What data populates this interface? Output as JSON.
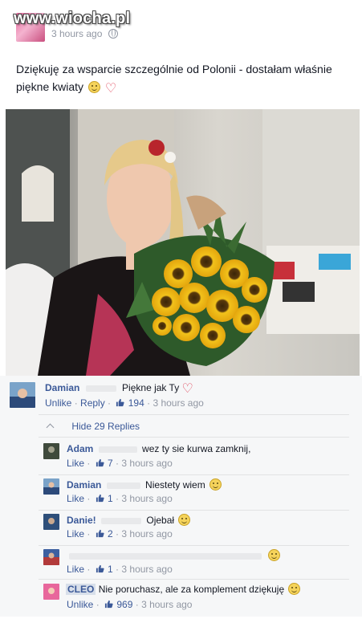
{
  "post": {
    "watermark": "www.wiocha.pl",
    "time": "3 hours ago",
    "text": "Dziękuję za wsparcie szczególnie od Polonii - dostałam właśnie piękne kwiaty",
    "icons": [
      "smile-icon",
      "heart-icon"
    ]
  },
  "comments": {
    "top": {
      "name": "Damian",
      "text": "Piękne jak Ty",
      "action": "Unlike",
      "reply": "Reply",
      "likes": "194",
      "time": "3 hours ago"
    },
    "hide_replies": "Hide 29 Replies",
    "replies": [
      {
        "name": "Adam",
        "text": "wez ty sie kurwa zamknij,",
        "action": "Like",
        "likes": "7",
        "time": "3 hours ago"
      },
      {
        "name": "Damian",
        "text": "Niestety wiem",
        "action": "Like",
        "likes": "1",
        "time": "3 hours ago"
      },
      {
        "name": "Danie!",
        "text": "Ojebał",
        "action": "Like",
        "likes": "2",
        "time": "3 hours ago"
      },
      {
        "name": "",
        "text": "",
        "action": "Like",
        "likes": "1",
        "time": "3 hours ago"
      },
      {
        "name": "CLEO",
        "text": "Nie poruchasz, ale za komplement dziękuję",
        "action": "Unlike",
        "likes": "969",
        "time": "3 hours ago"
      }
    ]
  },
  "colors": {
    "link": "#3b5998",
    "meta": "#9197a3",
    "background_comments": "#f6f7f8"
  }
}
